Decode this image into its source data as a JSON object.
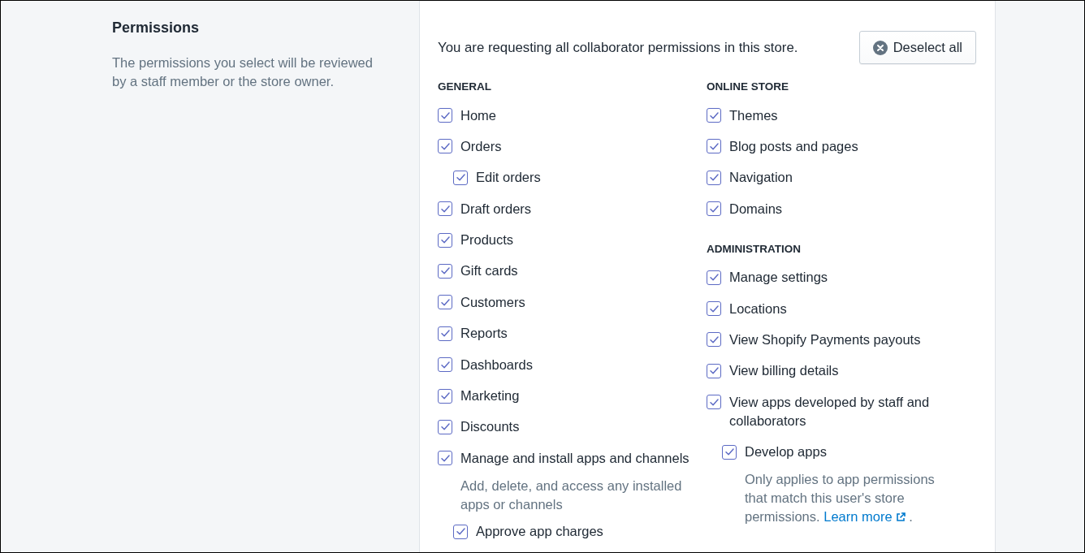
{
  "section": {
    "title": "Permissions",
    "description": "The permissions you select will be reviewed by a staff member or the store owner."
  },
  "card": {
    "summary": "You are requesting all collaborator permissions in this store.",
    "deselect_button": "Deselect all"
  },
  "columns": [
    {
      "groups": [
        {
          "heading": "GENERAL",
          "items": [
            {
              "label": "Home",
              "checked": true
            },
            {
              "label": "Orders",
              "checked": true,
              "children": [
                {
                  "label": "Edit orders",
                  "checked": true
                }
              ]
            },
            {
              "label": "Draft orders",
              "checked": true
            },
            {
              "label": "Products",
              "checked": true
            },
            {
              "label": "Gift cards",
              "checked": true
            },
            {
              "label": "Customers",
              "checked": true
            },
            {
              "label": "Reports",
              "checked": true
            },
            {
              "label": "Dashboards",
              "checked": true
            },
            {
              "label": "Marketing",
              "checked": true
            },
            {
              "label": "Discounts",
              "checked": true
            },
            {
              "label": "Manage and install apps and channels",
              "checked": true,
              "description": "Add, delete, and access any installed apps or channels",
              "children": [
                {
                  "label": "Approve app charges",
                  "checked": true
                }
              ]
            }
          ]
        }
      ]
    },
    {
      "groups": [
        {
          "heading": "ONLINE STORE",
          "items": [
            {
              "label": "Themes",
              "checked": true
            },
            {
              "label": "Blog posts and pages",
              "checked": true
            },
            {
              "label": "Navigation",
              "checked": true
            },
            {
              "label": "Domains",
              "checked": true
            }
          ]
        },
        {
          "heading": "ADMINISTRATION",
          "items": [
            {
              "label": "Manage settings",
              "checked": true
            },
            {
              "label": "Locations",
              "checked": true
            },
            {
              "label": "View Shopify Payments payouts",
              "checked": true
            },
            {
              "label": "View billing details",
              "checked": true
            },
            {
              "label": "View apps developed by staff and collaborators",
              "checked": true,
              "children": [
                {
                  "label": "Develop apps",
                  "checked": true,
                  "description": "Only applies to app permissions that match this user's store permissions.",
                  "link": "Learn more",
                  "after_link": "."
                }
              ]
            }
          ]
        }
      ]
    }
  ]
}
